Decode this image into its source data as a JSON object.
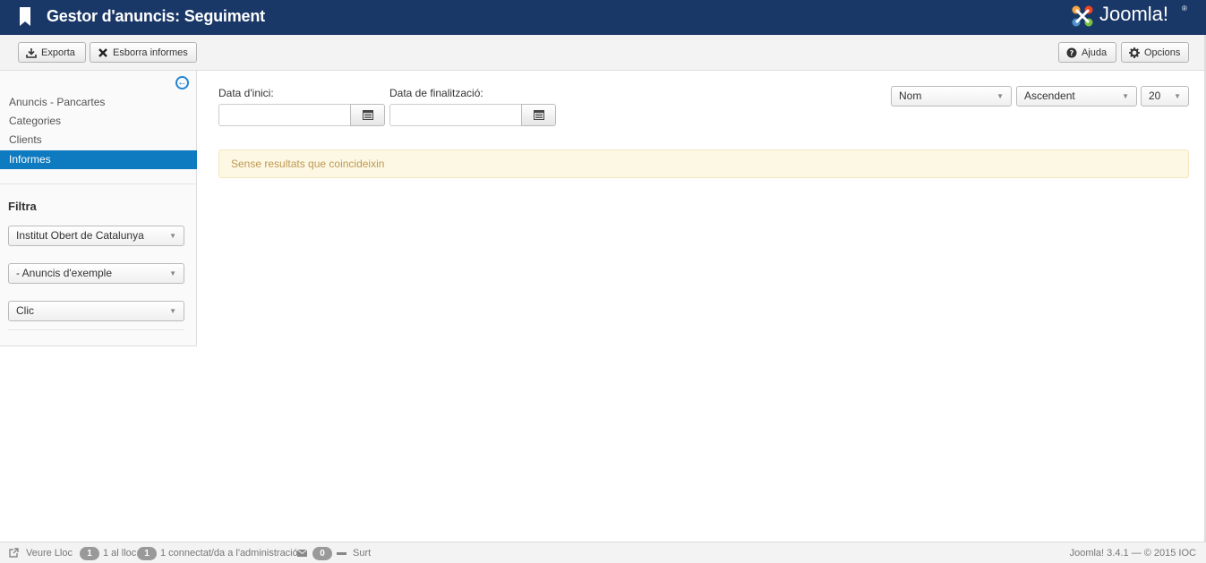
{
  "header": {
    "title": "Gestor d'anuncis: Seguiment",
    "logo_text": "Joomla!",
    "logo_reg": "®"
  },
  "toolbar": {
    "export_label": "Exporta",
    "delete_label": "Esborra informes",
    "help_label": "Ajuda",
    "options_label": "Opcions"
  },
  "sidebar": {
    "items": [
      {
        "label": "Anuncis - Pancartes"
      },
      {
        "label": "Categories"
      },
      {
        "label": "Clients"
      },
      {
        "label": "Informes"
      }
    ],
    "filter_title": "Filtra",
    "filters": [
      {
        "selected": "Institut Obert de Catalunya"
      },
      {
        "selected": "- Anuncis d'exemple"
      },
      {
        "selected": "Clic"
      }
    ]
  },
  "main": {
    "start_date_label": "Data d'inici:",
    "end_date_label": "Data de finalització:",
    "start_date_value": "",
    "end_date_value": "",
    "sort_field": "Nom",
    "sort_order": "Ascendent",
    "limit": "20",
    "no_results": "Sense resultats que coincideixin"
  },
  "footer": {
    "view_site": "Veure Lloc",
    "visitors_count": "1",
    "visitors_label": "1 al lloc",
    "admins_count": "1",
    "admins_label": "1 connectat/da a l'administració",
    "messages_count": "0",
    "logout": "Surt",
    "version": "Joomla! 3.4.1 — © 2015 IOC"
  },
  "colors": {
    "header_bg": "#1a3867",
    "active_nav": "#0e7ac0",
    "alert_bg": "#fcf8e3",
    "alert_text": "#c09853"
  }
}
